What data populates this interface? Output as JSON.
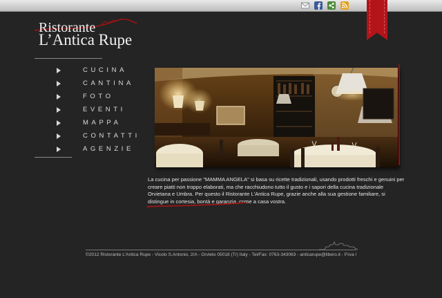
{
  "header": {
    "logo_line1": "Ristorante",
    "logo_line2": "L’Antica Rupe",
    "social_icons": [
      {
        "name": "email-icon",
        "color": "#9ea7b0"
      },
      {
        "name": "facebook-icon",
        "color": "#3b5998"
      },
      {
        "name": "share-icon",
        "color": "#4d8a3b"
      },
      {
        "name": "rss-icon",
        "color": "#e3a020"
      }
    ],
    "ribbon_color": "#b3141a"
  },
  "nav": {
    "items": [
      {
        "label": "CUCINA"
      },
      {
        "label": "CANTINA"
      },
      {
        "label": "FOTO"
      },
      {
        "label": "EVENTI"
      },
      {
        "label": "MAPPA"
      },
      {
        "label": "CONTATTI"
      },
      {
        "label": "AGENZIE"
      }
    ]
  },
  "main": {
    "description": "La cucina per passione \"MAMMA ANGELA\" si basa su ricette tradizionali, usando prodotti freschi e genuini per creare piatti non troppo elaborati, ma che racchiudono tutto il gusto e i sapori della cucina tradizionale Orvietana e Umbra. Per questo il Ristorante L'Antica Rupe, grazie anche alla sua gestione familiare, si distingue in cortesia, bontà e garanzia, come a casa vostra."
  },
  "footer": {
    "text": "©2012 Ristorante L'Antica Rupe - Vicolo S.Antonio, 2/A - Orvieto 05018 (Tr) Italy - Tel/Fax: 0763-343063 - anticarupe@libero.it - P.iva 01479170555"
  },
  "colors": {
    "background": "#242424",
    "accent_red": "#b3141a"
  }
}
